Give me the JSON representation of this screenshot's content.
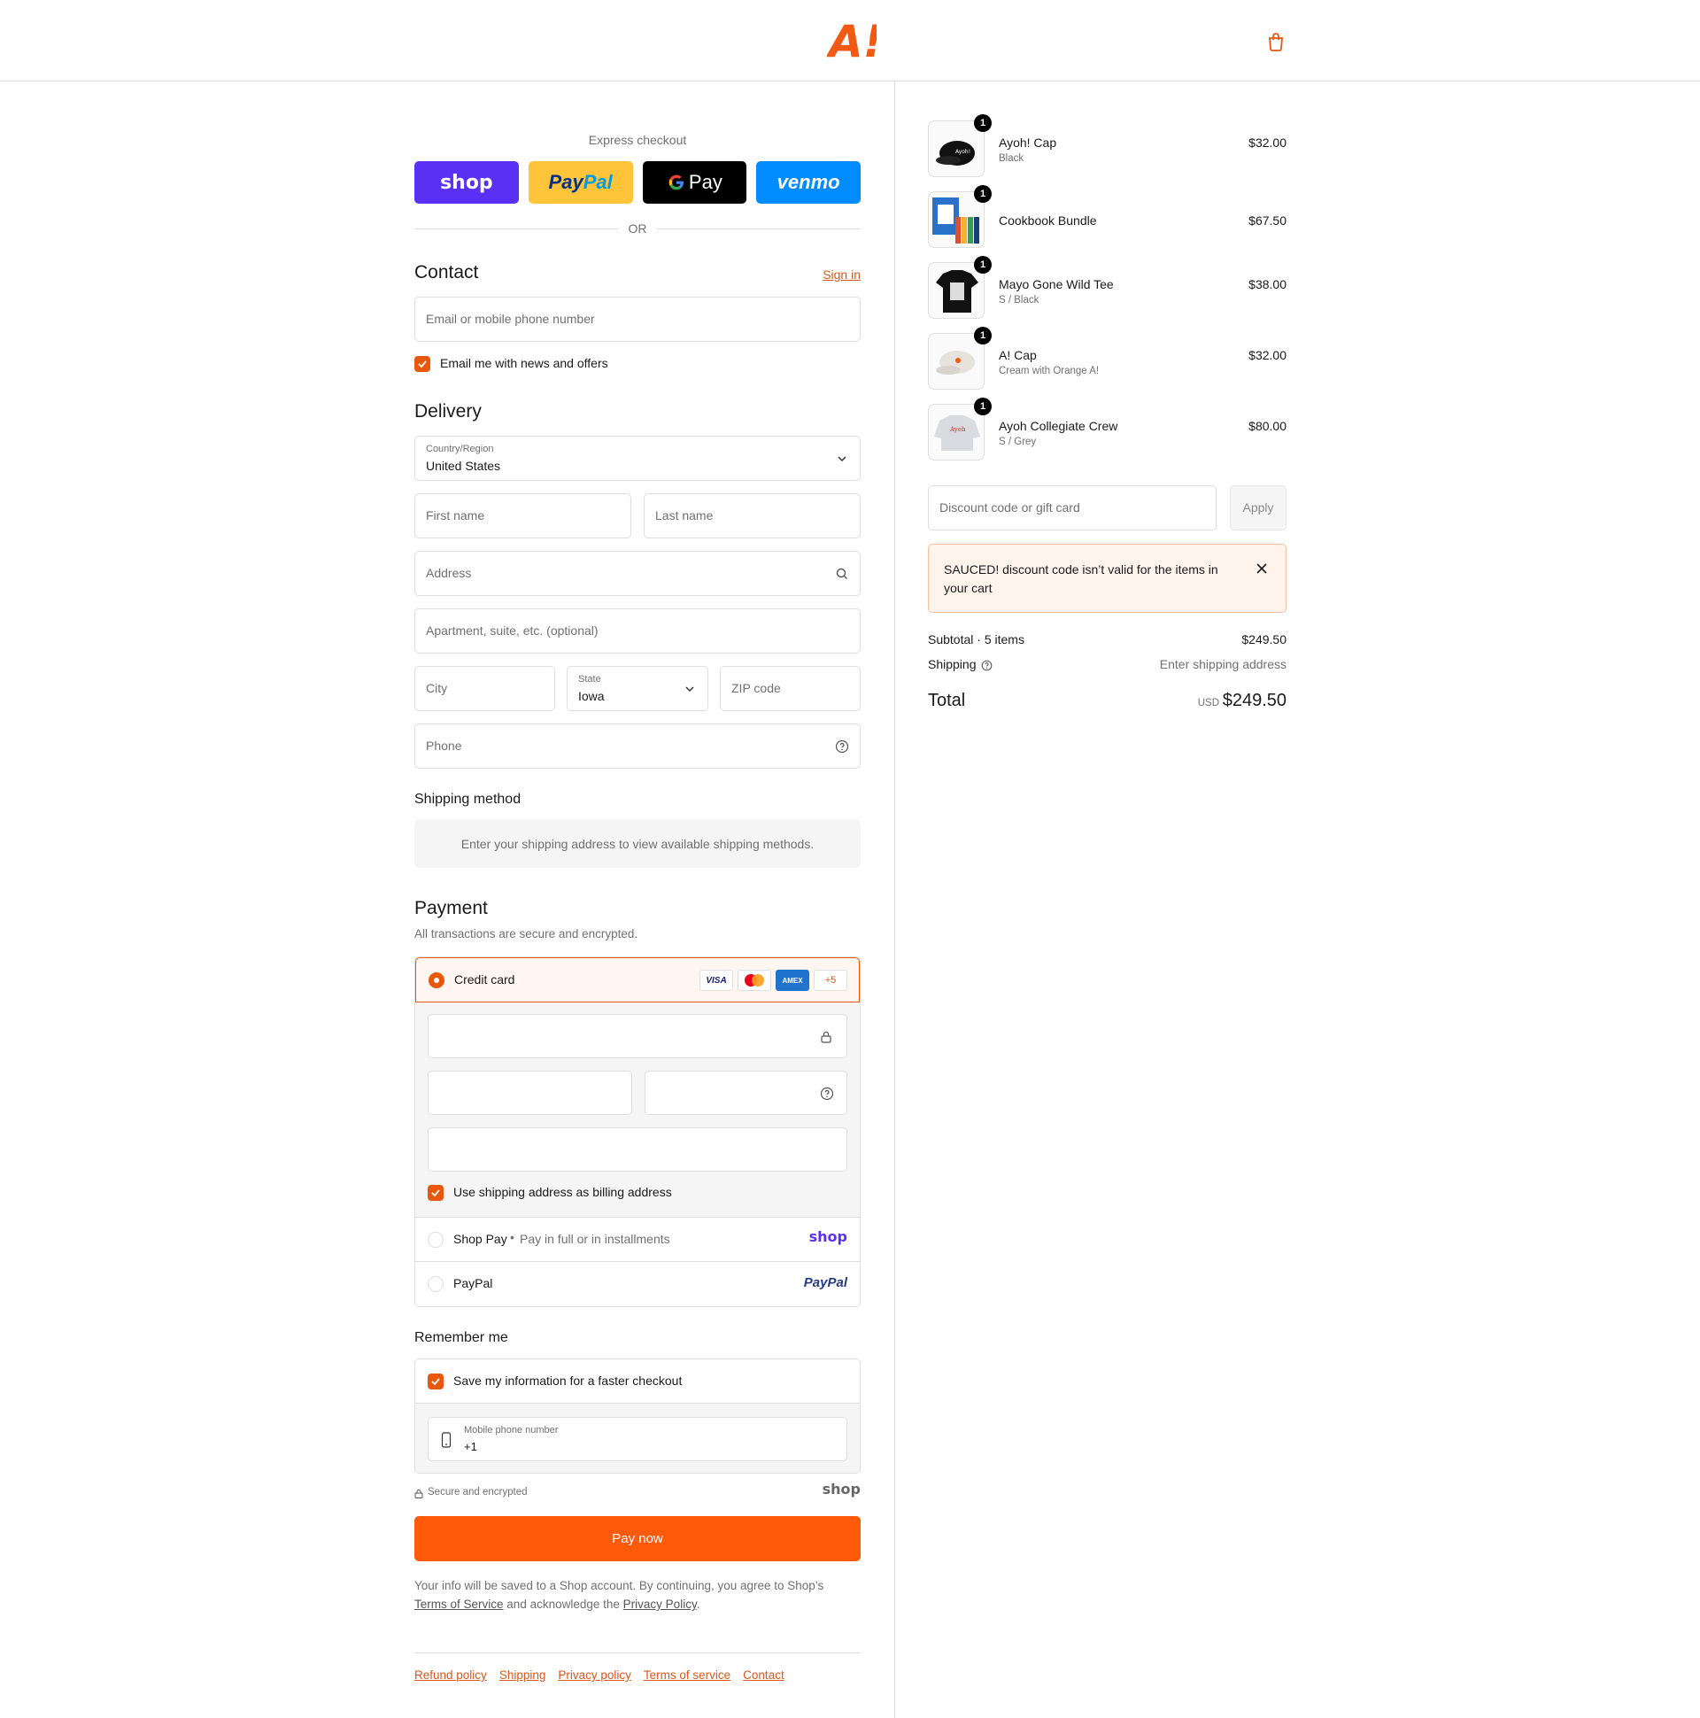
{
  "header": {
    "logo_text": "A!",
    "cart_icon": "shopping-bag-icon"
  },
  "express": {
    "title": "Express checkout",
    "buttons": {
      "shop": "shop",
      "paypal": "PayPal",
      "gpay": "Pay",
      "venmo": "venmo"
    },
    "or": "OR"
  },
  "contact": {
    "title": "Contact",
    "sign_in": "Sign in",
    "email_placeholder": "Email or mobile phone number",
    "news_label": "Email me with news and offers"
  },
  "delivery": {
    "title": "Delivery",
    "country_label": "Country/Region",
    "country_value": "United States",
    "first_name": "First name",
    "last_name": "Last name",
    "address": "Address",
    "apartment": "Apartment, suite, etc. (optional)",
    "city": "City",
    "state_label": "State",
    "state_value": "Iowa",
    "zip": "ZIP code",
    "phone": "Phone"
  },
  "shipping_method": {
    "title": "Shipping method",
    "message": "Enter your shipping address to view available shipping methods."
  },
  "payment": {
    "title": "Payment",
    "subtitle": "All transactions are secure and encrypted.",
    "credit_card": "Credit card",
    "cards": {
      "visa": "VISA",
      "amex": "AMEX",
      "more": "+5"
    },
    "billing_label": "Use shipping address as billing address",
    "shop_pay": "Shop Pay",
    "shop_pay_sub": "Pay in full or in installments",
    "shop_pay_logo": "shop",
    "paypal": "PayPal",
    "paypal_logo": "PayPal"
  },
  "remember": {
    "title": "Remember me",
    "save_label": "Save my information for a faster checkout",
    "mobile_label": "Mobile phone number",
    "mobile_value": "+1"
  },
  "secure": {
    "text": "Secure and encrypted",
    "logo": "shop"
  },
  "pay_now": "Pay now",
  "legal": {
    "part1": "Your info will be saved to a Shop account. By continuing, you agree to Shop’s",
    "tos": "Terms of Service",
    "part2": "and acknowledge the",
    "privacy": "Privacy Policy",
    "end": "."
  },
  "footer_links": [
    "Refund policy",
    "Shipping",
    "Privacy policy",
    "Terms of service",
    "Contact"
  ],
  "cart": {
    "items": [
      {
        "name": "Ayoh! Cap",
        "variant": "Black",
        "price": "$32.00",
        "qty": "1"
      },
      {
        "name": "Cookbook Bundle",
        "variant": "",
        "price": "$67.50",
        "qty": "1"
      },
      {
        "name": "Mayo Gone Wild Tee",
        "variant": "S / Black",
        "price": "$38.00",
        "qty": "1"
      },
      {
        "name": "A! Cap",
        "variant": "Cream with Orange A!",
        "price": "$32.00",
        "qty": "1"
      },
      {
        "name": "Ayoh Collegiate Crew",
        "variant": "S / Grey",
        "price": "$80.00",
        "qty": "1"
      }
    ],
    "discount_placeholder": "Discount code or gift card",
    "apply": "Apply",
    "alert": "SAUCED! discount code isn’t valid for the items in your cart",
    "subtotal_label": "Subtotal · 5 items",
    "subtotal_value": "$249.50",
    "shipping_label": "Shipping",
    "shipping_value": "Enter shipping address",
    "total_label": "Total",
    "currency": "USD",
    "total_value": "$249.50"
  },
  "colors": {
    "accent": "#ff5a0a",
    "brand_orange": "#e8580c",
    "shop_purple": "#5a31f4",
    "venmo_blue": "#008cff",
    "paypal_yellow": "#ffc439"
  }
}
